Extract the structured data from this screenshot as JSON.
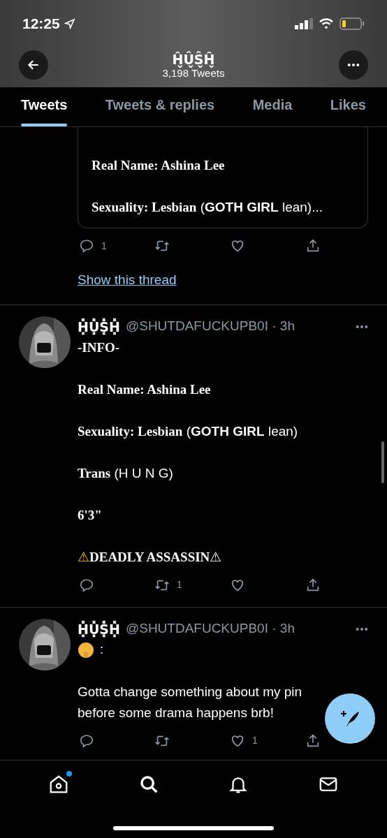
{
  "status_bar": {
    "time": "12:25"
  },
  "header": {
    "name": "Ĥ̬Û̬Ŝ̬Ĥ̬",
    "tweet_count": "3,198 Tweets"
  },
  "tabs": [
    {
      "label": "Tweets",
      "selected": true
    },
    {
      "label": "Tweets & replies",
      "selected": false
    },
    {
      "label": "Media",
      "selected": false
    },
    {
      "label": "Likes",
      "selected": false
    }
  ],
  "tweets": [
    {
      "kind": "continued",
      "quote_lines": [
        [
          {
            "text": "Real Name: Ashina Lee",
            "kind": "serif"
          }
        ],
        [
          {
            "text": "Sexuality: Lesbian",
            "kind": "serif"
          },
          {
            "text": " (",
            "kind": "plain"
          },
          {
            "text": "GOTH GIRL",
            "kind": "bold"
          },
          {
            "text": " lean)...",
            "kind": "plain"
          }
        ]
      ],
      "actions": {
        "replies": "1"
      },
      "thread_link": "Show this thread"
    },
    {
      "kind": "full",
      "name": "H͓̽U͓̽S͓̽H͓̽",
      "handle": "@SHUTDAFUCKUPB0I · 3h",
      "lines": [
        [
          {
            "text": "-INFO-",
            "kind": "serif"
          }
        ],
        [
          {
            "text": "Real Name: Ashina Lee",
            "kind": "serif"
          }
        ],
        [
          {
            "text": "Sexuality: Lesbian",
            "kind": "serif"
          },
          {
            "text": " (",
            "kind": "plain"
          },
          {
            "text": "GOTH GIRL",
            "kind": "bold"
          },
          {
            "text": " lean)",
            "kind": "plain"
          }
        ],
        [
          {
            "text": "Trans",
            "kind": "serif"
          },
          {
            "text": " (H U N G)",
            "kind": "plain"
          }
        ],
        [
          {
            "text": "6'3\"",
            "kind": "serif"
          }
        ],
        [
          {
            "text": "⚠",
            "kind": "warning"
          },
          {
            "text": "DEADLY ASSASSIN",
            "kind": "serif"
          },
          {
            "text": "⚠",
            "kind": "plain"
          }
        ]
      ],
      "actions": {
        "retweets": "1"
      }
    },
    {
      "kind": "full",
      "name": "H͓̽U͓̽S͓̽H͓̽",
      "handle": "@SHUTDAFUCKUPB0I · 3h",
      "emoji_line": ":",
      "lines": [
        [
          {
            "text": "Gotta change something about my pin before some drama happens brb!",
            "kind": "plain"
          }
        ]
      ],
      "actions": {
        "likes": "1"
      }
    }
  ],
  "bottom_nav": [
    {
      "selected": false,
      "dot": true
    },
    {
      "selected": true,
      "dot": false
    },
    {
      "selected": false,
      "dot": false
    },
    {
      "selected": false,
      "dot": false
    }
  ]
}
